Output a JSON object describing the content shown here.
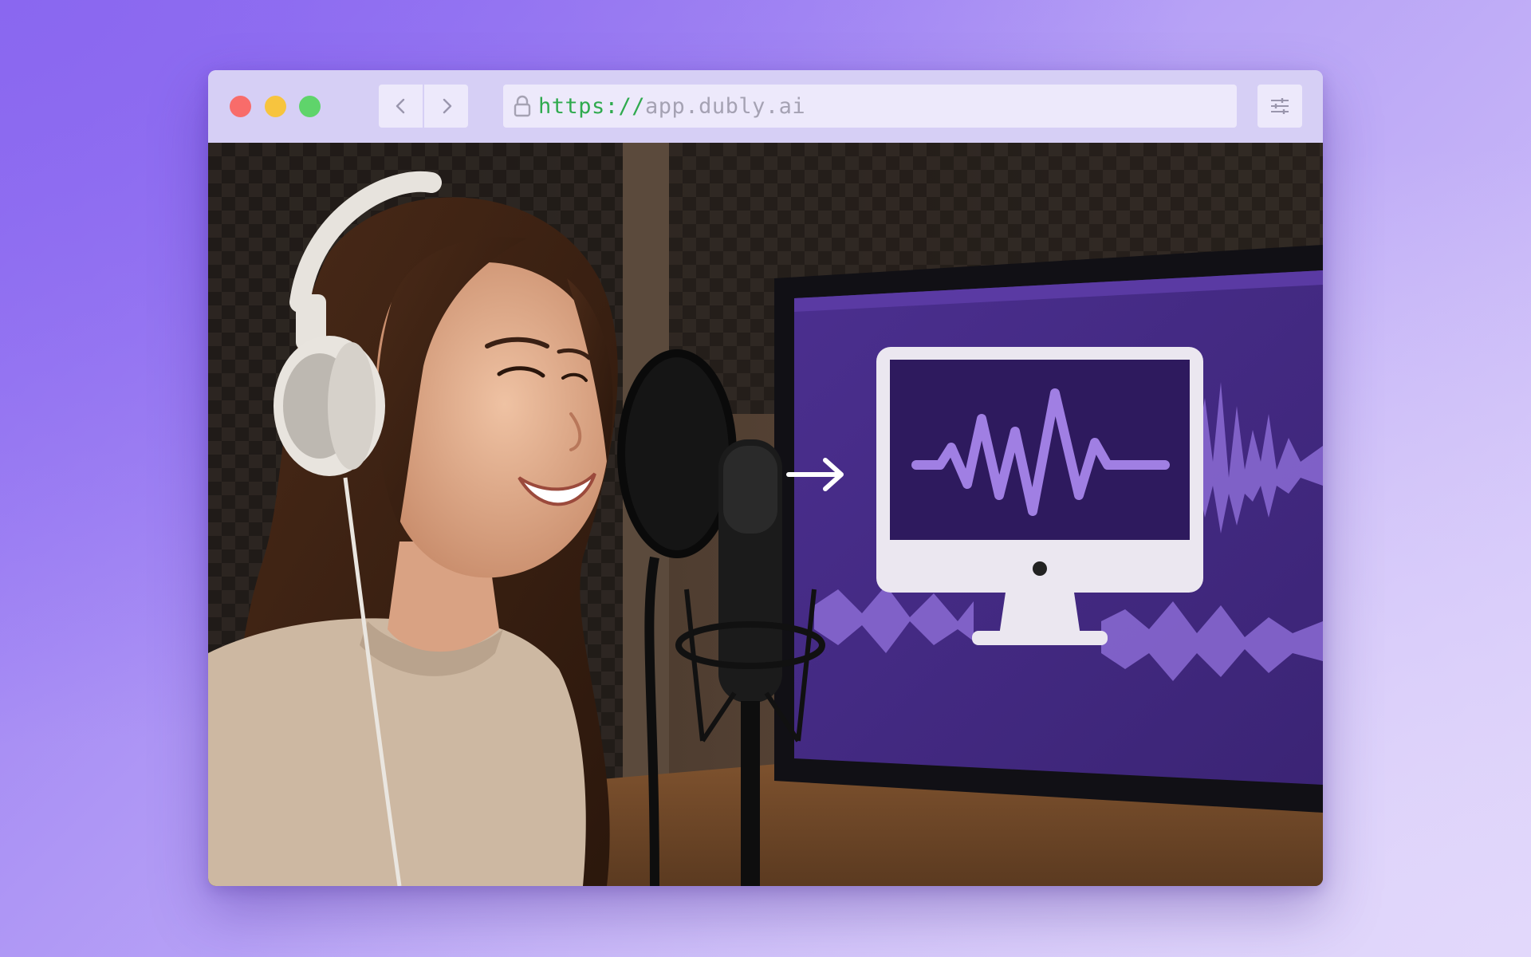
{
  "browser": {
    "window_controls": [
      "close",
      "minimize",
      "maximize"
    ],
    "nav": {
      "back_icon": "chevron-left-icon",
      "forward_icon": "chevron-right-icon"
    },
    "address": {
      "lock_icon": "lock-icon",
      "protocol": "https://",
      "host": "app.dubly.ai"
    },
    "settings_icon": "sliders-icon"
  },
  "content_image": {
    "alt": "Smiling woman wearing white headphones speaking into a studio microphone with pop filter, next to a monitor showing purple audio waveforms and an arrow pointing to a computer icon with a waveform"
  },
  "colors": {
    "background_gradient_start": "#8a67f0",
    "background_gradient_end": "#e2d8fb",
    "titlebar": "#d6cff5",
    "button_bg": "#ede9fb",
    "close": "#f86c6a",
    "minimize": "#f7c43e",
    "maximize": "#5fd46b",
    "url_protocol": "#2faa4e",
    "url_host": "#a5a2b3",
    "waveform_purple": "#9f7be0",
    "screen_purple": "#2e1a5e"
  }
}
